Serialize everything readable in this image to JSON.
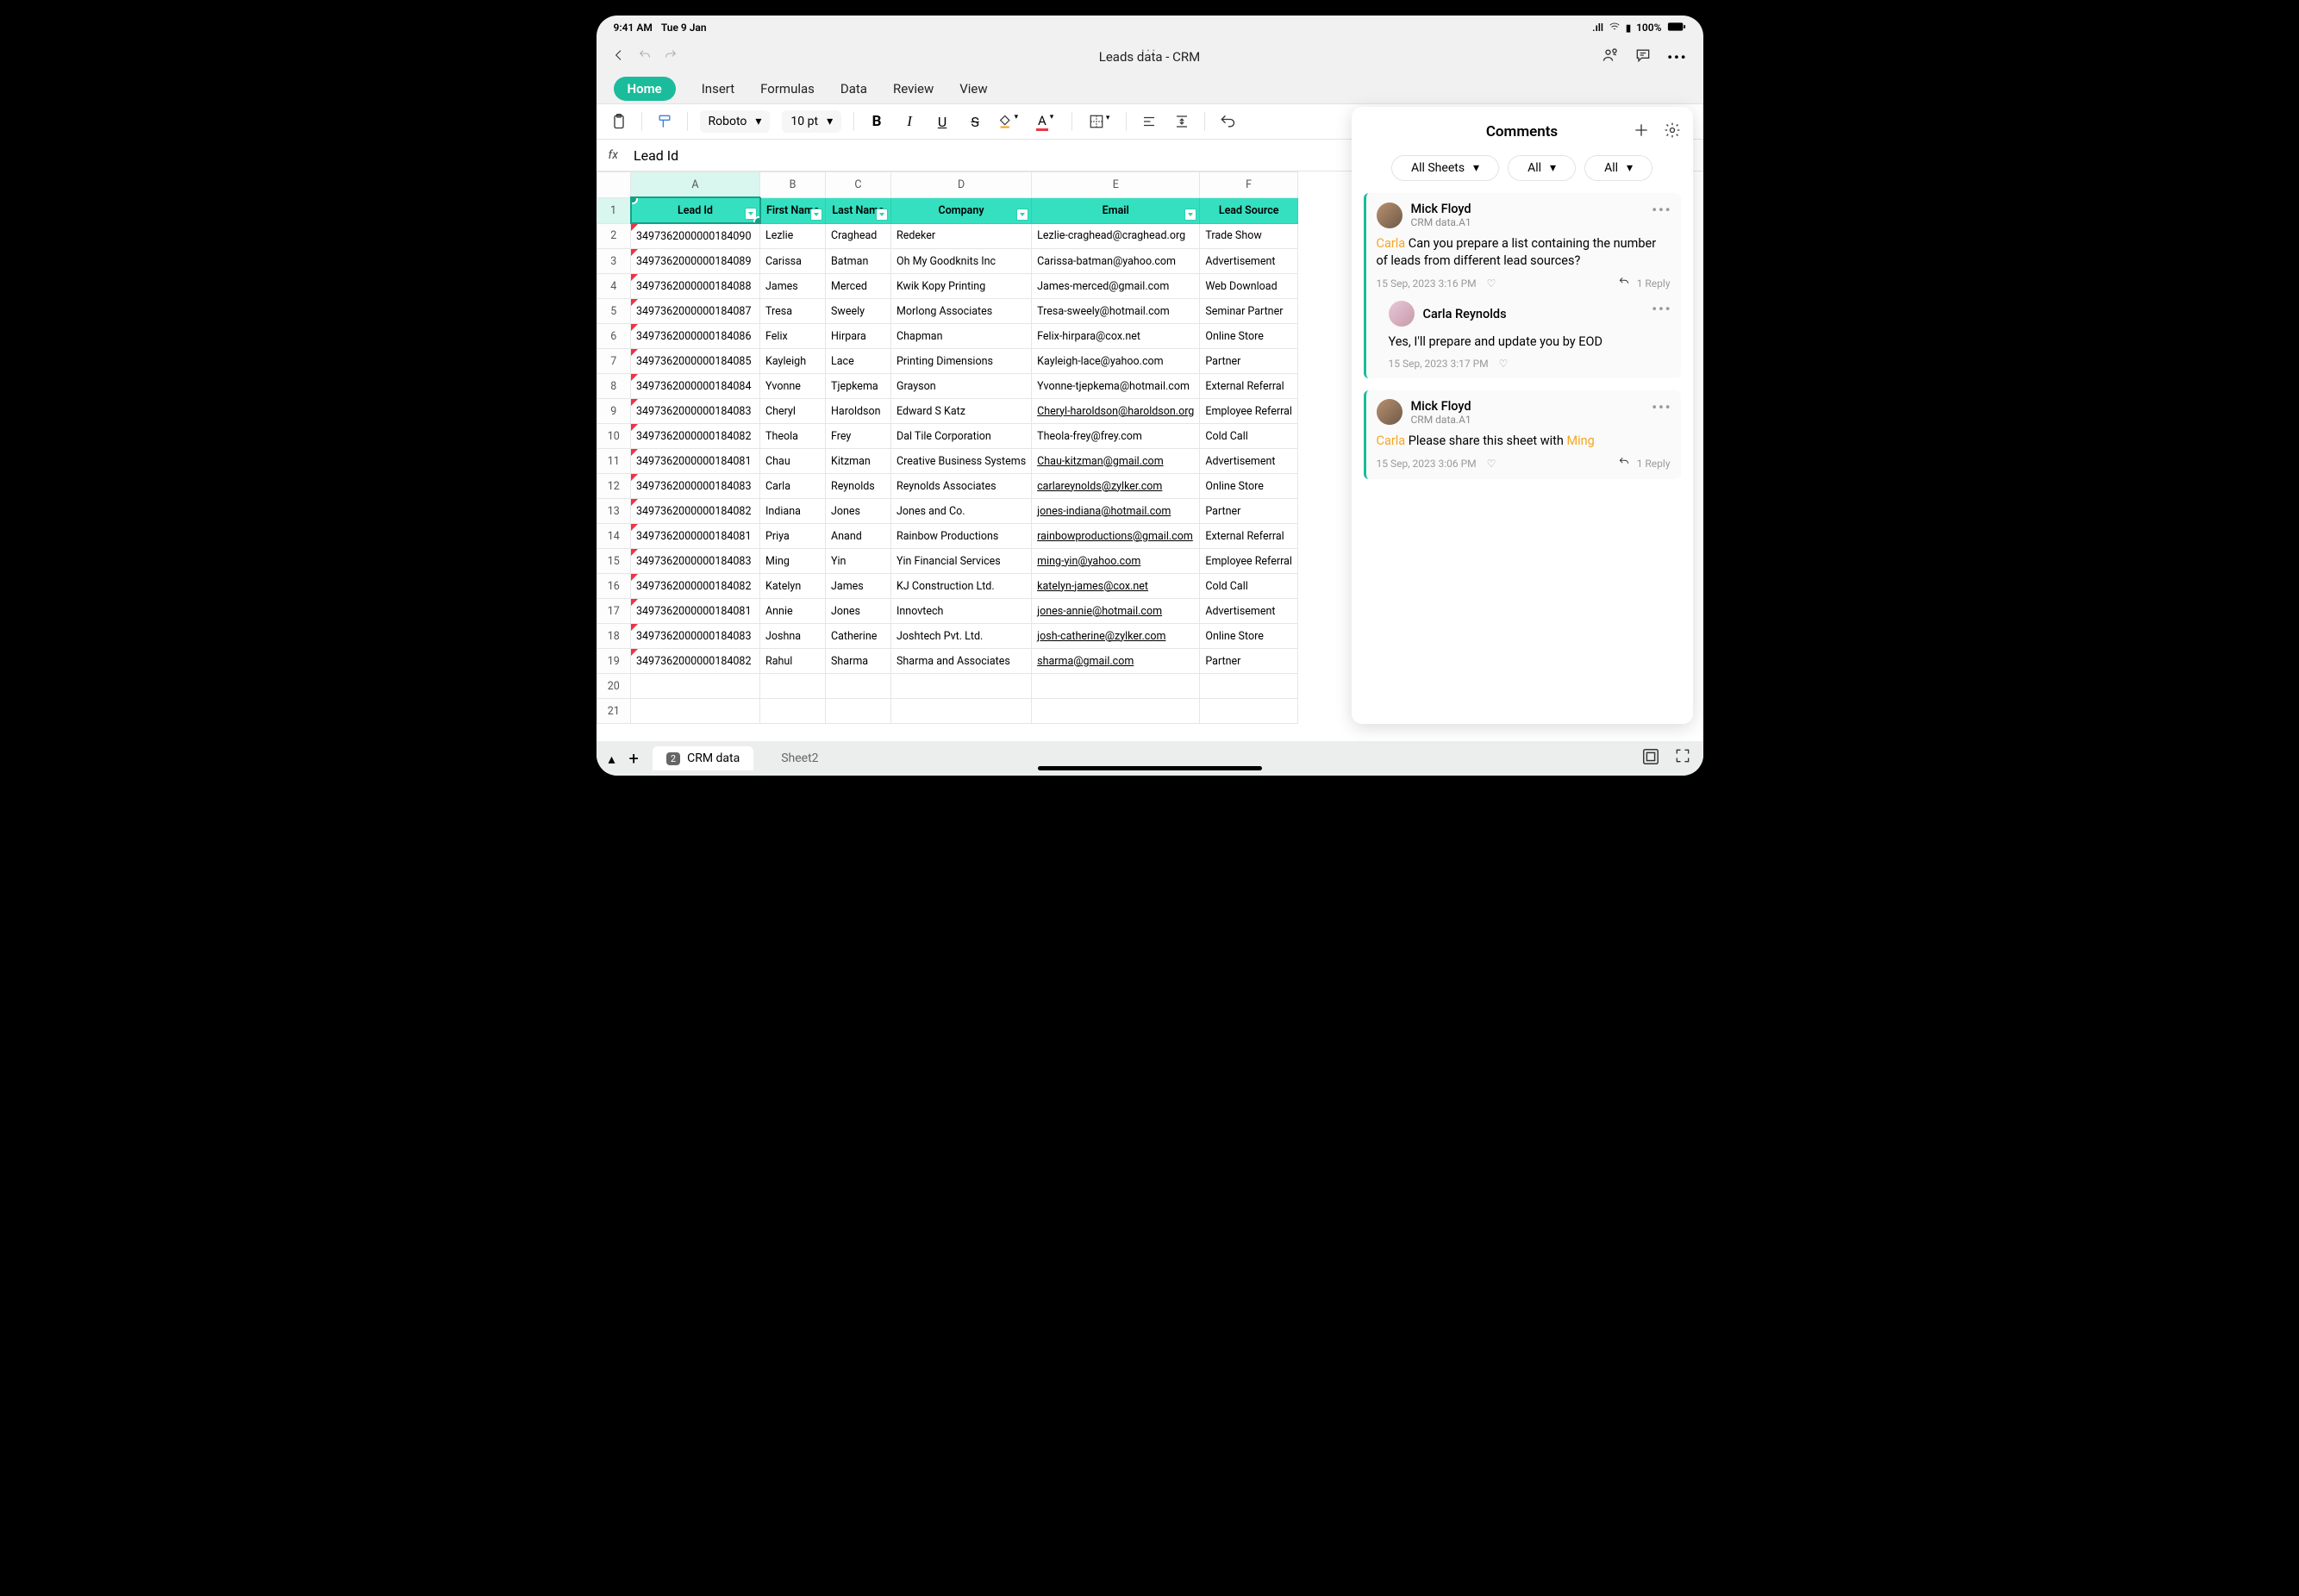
{
  "status": {
    "time": "9:41 AM",
    "date": "Tue 9 Jan",
    "battery": "100%"
  },
  "doc": {
    "title": "Leads data - CRM"
  },
  "tabs": {
    "home": "Home",
    "insert": "Insert",
    "formulas": "Formulas",
    "data": "Data",
    "review": "Review",
    "view": "View"
  },
  "toolbar": {
    "font": "Roboto",
    "size": "10 pt"
  },
  "formula": {
    "value": "Lead Id"
  },
  "columns": [
    "A",
    "B",
    "C",
    "D",
    "E",
    "F"
  ],
  "headers": {
    "A": "Lead Id",
    "B": "First Name",
    "C": "Last Name",
    "D": "Company",
    "E": "Email",
    "F": "Lead Source"
  },
  "rows": [
    {
      "n": 2,
      "A": "3497362000000184090",
      "B": "Lezlie",
      "C": "Craghead",
      "D": "Redeker",
      "E": "Lezlie-craghead@craghead.org",
      "F": "Trade Show",
      "link": false
    },
    {
      "n": 3,
      "A": "3497362000000184089",
      "B": "Carissa",
      "C": "Batman",
      "D": "Oh My Goodknits Inc",
      "E": "Carissa-batman@yahoo.com",
      "F": "Advertisement",
      "link": false
    },
    {
      "n": 4,
      "A": "3497362000000184088",
      "B": "James",
      "C": "Merced",
      "D": "Kwik Kopy Printing",
      "E": "James-merced@gmail.com",
      "F": "Web Download",
      "link": false
    },
    {
      "n": 5,
      "A": "3497362000000184087",
      "B": "Tresa",
      "C": "Sweely",
      "D": "Morlong Associates",
      "E": "Tresa-sweely@hotmail.com",
      "F": "Seminar Partner",
      "link": false
    },
    {
      "n": 6,
      "A": "3497362000000184086",
      "B": "Felix",
      "C": "Hirpara",
      "D": "Chapman",
      "E": "Felix-hirpara@cox.net",
      "F": "Online Store",
      "link": false
    },
    {
      "n": 7,
      "A": "3497362000000184085",
      "B": "Kayleigh",
      "C": "Lace",
      "D": "Printing Dimensions",
      "E": "Kayleigh-lace@yahoo.com",
      "F": "Partner",
      "link": false
    },
    {
      "n": 8,
      "A": "3497362000000184084",
      "B": "Yvonne",
      "C": "Tjepkema",
      "D": "Grayson",
      "E": "Yvonne-tjepkema@hotmail.com",
      "F": "External Referral",
      "link": false
    },
    {
      "n": 9,
      "A": "3497362000000184083",
      "B": "Cheryl",
      "C": "Haroldson",
      "D": "Edward S Katz",
      "E": "Cheryl-haroldson@haroldson.org",
      "F": "Employee Referral",
      "link": true
    },
    {
      "n": 10,
      "A": "3497362000000184082",
      "B": "Theola",
      "C": "Frey",
      "D": "Dal Tile Corporation",
      "E": "Theola-frey@frey.com",
      "F": "Cold Call",
      "link": false
    },
    {
      "n": 11,
      "A": "3497362000000184081",
      "B": "Chau",
      "C": "Kitzman",
      "D": "Creative Business Systems",
      "E": "Chau-kitzman@gmail.com",
      "F": "Advertisement",
      "link": true
    },
    {
      "n": 12,
      "A": "3497362000000184083",
      "B": "Carla",
      "C": "Reynolds",
      "D": "Reynolds Associates",
      "E": "carlareynolds@zylker.com",
      "F": "Online Store",
      "link": true
    },
    {
      "n": 13,
      "A": "3497362000000184082",
      "B": "Indiana",
      "C": "Jones",
      "D": "Jones and Co.",
      "E": "jones-indiana@hotmail.com",
      "F": "Partner",
      "link": true
    },
    {
      "n": 14,
      "A": "3497362000000184081",
      "B": "Priya",
      "C": "Anand",
      "D": "Rainbow Productions",
      "E": "rainbowproductions@gmail.com",
      "F": "External Referral",
      "link": true
    },
    {
      "n": 15,
      "A": "3497362000000184083",
      "B": "Ming",
      "C": "Yin",
      "D": "Yin Financial Services",
      "E": "ming-yin@yahoo.com",
      "F": "Employee Referral",
      "link": true
    },
    {
      "n": 16,
      "A": "3497362000000184082",
      "B": "Katelyn",
      "C": "James",
      "D": "KJ Construction Ltd.",
      "E": "katelyn-james@cox.net",
      "F": "Cold Call",
      "link": true
    },
    {
      "n": 17,
      "A": "3497362000000184081",
      "B": "Annie",
      "C": "Jones",
      "D": "Innovtech",
      "E": "jones-annie@hotmail.com",
      "F": "Advertisement",
      "link": true
    },
    {
      "n": 18,
      "A": "3497362000000184083",
      "B": "Joshna",
      "C": "Catherine",
      "D": "Joshtech Pvt. Ltd.",
      "E": "josh-catherine@zylker.com",
      "F": "Online Store",
      "link": true
    },
    {
      "n": 19,
      "A": "3497362000000184082",
      "B": "Rahul",
      "C": "Sharma",
      "D": "Sharma and Associates",
      "E": "sharma@gmail.com",
      "F": "Partner",
      "link": true
    }
  ],
  "emptyRows": [
    20,
    21
  ],
  "sheets": {
    "active": "CRM data",
    "badge": "2",
    "other": "Sheet2"
  },
  "commentsPanel": {
    "title": "Comments",
    "filter1": "All Sheets",
    "filter2": "All",
    "filter3": "All",
    "threads": [
      {
        "user": "Mick Floyd",
        "loc": "CRM data.A1",
        "mention": "Carla",
        "text": " Can you prepare a list containing the number of leads from different lead sources?",
        "time": "15 Sep, 2023 3:16 PM",
        "replies": "1 Reply",
        "sub": {
          "user": "Carla Reynolds",
          "text": "Yes, I'll prepare and update you by EOD",
          "time": "15 Sep, 2023 3:17 PM"
        }
      },
      {
        "user": "Mick Floyd",
        "loc": "CRM data.A1",
        "mention": "Carla",
        "text": " Please share this sheet with ",
        "mention2": "Ming",
        "time": "15 Sep, 2023 3:06 PM",
        "replies": "1 Reply"
      }
    ]
  }
}
